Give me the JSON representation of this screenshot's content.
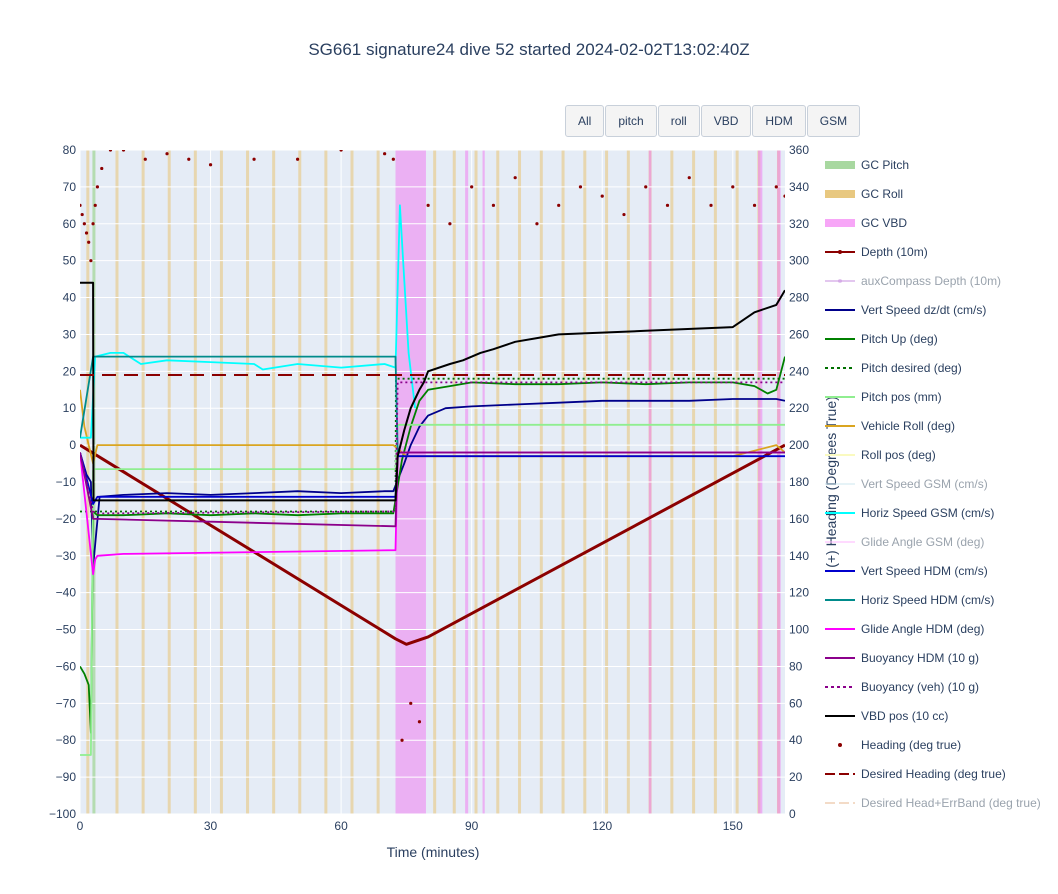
{
  "title": "SG661 signature24 dive 52 started 2024-02-02T13:02:40Z",
  "buttons": [
    "All",
    "pitch",
    "roll",
    "VBD",
    "HDM",
    "GSM"
  ],
  "colors": {
    "plot_bg": "#e5ecf6",
    "gc_pitch": "#a8d8a0",
    "gc_roll": "#e8c880",
    "gc_vbd": "#f080f0",
    "depth": "#8b0000",
    "aux_depth": "#c890e0",
    "vert_speed_dzdt": "#00008b",
    "pitch_up": "#008000",
    "pitch_desired": "#007000",
    "pitch_pos": "#90ee90",
    "vehicle_roll": "#daa520",
    "roll_pos": "#fafac0",
    "vert_speed_gsm": "#add8e6",
    "horiz_speed_gsm": "#00ffff",
    "glide_angle_gsm": "#ffb6ff",
    "vert_speed_hdm": "#0000cd",
    "horiz_speed_hdm": "#008b8b",
    "glide_angle_hdm": "#ff00ff",
    "buoyancy_hdm": "#8b008b",
    "buoyancy_veh": "#8b008b",
    "vbd_pos": "#000000",
    "heading": "#8b0000",
    "desired_heading": "#8b0000",
    "errband": "#e8b890"
  },
  "legend": [
    {
      "label": "GC Pitch",
      "symbol": "band",
      "color": "#a8d8a0",
      "visible": true
    },
    {
      "label": "GC Roll",
      "symbol": "band",
      "color": "#e8c880",
      "visible": true
    },
    {
      "label": "GC VBD",
      "symbol": "band",
      "color": "#f7a6f7",
      "visible": true
    },
    {
      "label": "Depth (10m)",
      "symbol": "line-marker",
      "color": "#8b0000",
      "visible": true
    },
    {
      "label": "auxCompass Depth (10m)",
      "symbol": "line-marker",
      "color": "#c890e0",
      "visible": false
    },
    {
      "label": "Vert Speed dz/dt (cm/s)",
      "symbol": "line",
      "color": "#00008b",
      "visible": true
    },
    {
      "label": "Pitch Up (deg)",
      "symbol": "line",
      "color": "#008000",
      "visible": true
    },
    {
      "label": "Pitch desired (deg)",
      "symbol": "dot",
      "color": "#007000",
      "visible": true
    },
    {
      "label": "Pitch pos (mm)",
      "symbol": "line",
      "color": "#90ee90",
      "visible": true
    },
    {
      "label": "Vehicle Roll (deg)",
      "symbol": "line",
      "color": "#daa520",
      "visible": true
    },
    {
      "label": "Roll pos (deg)",
      "symbol": "line",
      "color": "#fafac0",
      "visible": true
    },
    {
      "label": "Vert Speed GSM (cm/s)",
      "symbol": "line",
      "color": "#cfe8f0",
      "visible": false
    },
    {
      "label": "Horiz Speed GSM (cm/s)",
      "symbol": "line",
      "color": "#00ffff",
      "visible": true
    },
    {
      "label": "Glide Angle GSM (deg)",
      "symbol": "line",
      "color": "#ffb6ff",
      "visible": false
    },
    {
      "label": "Vert Speed HDM (cm/s)",
      "symbol": "line",
      "color": "#0000cd",
      "visible": true
    },
    {
      "label": "Horiz Speed HDM (cm/s)",
      "symbol": "line",
      "color": "#008b8b",
      "visible": true
    },
    {
      "label": "Glide Angle HDM (deg)",
      "symbol": "line",
      "color": "#ff00ff",
      "visible": true
    },
    {
      "label": "Buoyancy HDM (10 g)",
      "symbol": "line",
      "color": "#8b008b",
      "visible": true
    },
    {
      "label": "Buoyancy (veh) (10 g)",
      "symbol": "dot",
      "color": "#8b008b",
      "visible": true
    },
    {
      "label": "VBD pos (10 cc)",
      "symbol": "line",
      "color": "#000000",
      "visible": true
    },
    {
      "label": "Heading (deg true)",
      "symbol": "marker",
      "color": "#8b0000",
      "visible": true
    },
    {
      "label": "Desired Heading (deg true)",
      "symbol": "dash",
      "color": "#8b0000",
      "visible": true
    },
    {
      "label": "Desired Head+ErrBand (deg true)",
      "symbol": "dash",
      "color": "#e8b890",
      "visible": false
    }
  ],
  "chart_data": {
    "type": "line",
    "title": "SG661 signature24 dive 52 started 2024-02-02T13:02:40Z",
    "xlabel": "Time (minutes)",
    "ylabel": "",
    "y2label": "(+) Heading (Degrees True)",
    "xlim": [
      0,
      162
    ],
    "ylim": [
      -100,
      80
    ],
    "y2lim": [
      0,
      360
    ],
    "xticks": [
      0,
      30,
      60,
      90,
      120,
      150
    ],
    "yticks": [
      80,
      70,
      60,
      50,
      40,
      30,
      20,
      10,
      0,
      -10,
      -20,
      -30,
      -40,
      -50,
      -60,
      -70,
      -80,
      -90,
      -100
    ],
    "y2ticks": [
      360,
      340,
      320,
      300,
      280,
      260,
      240,
      220,
      200,
      180,
      160,
      140,
      120,
      100,
      80,
      60,
      40,
      20,
      0
    ],
    "grid": true,
    "legend_position": "right",
    "gc_pitch_x": [
      3.2
    ],
    "gc_roll_x": [
      1.8,
      8.5,
      14.5,
      20.5,
      26.5,
      32.5,
      38.5,
      44.5,
      50.5,
      56.5,
      62.5,
      68.5,
      81.5,
      86,
      91,
      96,
      101,
      106,
      111,
      116,
      121,
      126,
      131,
      136,
      141,
      146,
      151,
      156,
      160.5
    ],
    "gc_vbd_bands": [
      [
        72.5,
        79.5
      ],
      [
        88.5,
        89.2
      ],
      [
        92.5,
        93
      ],
      [
        130.7,
        131.3
      ],
      [
        155.8,
        156.8
      ],
      [
        160.2,
        161
      ]
    ],
    "series": [
      {
        "name": "Depth (10m)",
        "x": [
          0,
          72.5,
          75,
          80,
          162
        ],
        "y": [
          0,
          -52.5,
          -54,
          -52,
          0
        ],
        "y_unit": "10m"
      },
      {
        "name": "Vert Speed dz/dt (cm/s)",
        "x": [
          0,
          1.5,
          2.5,
          3.0,
          4.5,
          10,
          20,
          30,
          40,
          50,
          60,
          70,
          72,
          74.5,
          76,
          78,
          80,
          84,
          90,
          100,
          110,
          120,
          130,
          140,
          150,
          160,
          162
        ],
        "y": [
          -2,
          -8,
          -10,
          -33,
          -14,
          -13.5,
          -13,
          -13.5,
          -13,
          -12.5,
          -13,
          -12.5,
          -12.5,
          -5,
          0,
          5,
          8,
          10,
          10.5,
          11,
          11.5,
          12,
          12,
          12,
          12.5,
          12.5,
          12
        ]
      },
      {
        "name": "Pitch Up (deg)",
        "x": [
          0,
          1,
          2,
          2.5,
          3,
          4,
          10,
          20,
          30,
          40,
          50,
          60,
          70,
          72,
          74,
          76,
          78,
          80,
          85,
          90,
          100,
          110,
          120,
          130,
          140,
          150,
          155,
          158,
          160,
          162
        ],
        "y": [
          -60,
          -62,
          -65,
          -78,
          -18,
          -19,
          -19,
          -18.5,
          -19,
          -18.5,
          -19,
          -18.5,
          -18.5,
          -18.5,
          -4,
          5,
          12,
          15,
          16,
          17,
          16.5,
          16.5,
          17,
          16.5,
          17,
          17,
          16,
          14,
          15,
          24
        ]
      },
      {
        "name": "Pitch desired (deg)",
        "x": [
          0,
          72.5,
          72.6,
          162
        ],
        "y": [
          -18,
          -18,
          18,
          18
        ],
        "dash": "dot"
      },
      {
        "name": "Pitch pos (mm)",
        "x": [
          0,
          2.5,
          3,
          3.2,
          72.5,
          73,
          80,
          162
        ],
        "y": [
          -84,
          -84,
          -7,
          -6.5,
          -6.5,
          5.5,
          5.5,
          5.5
        ]
      },
      {
        "name": "Vehicle Roll (deg)",
        "x": [
          0,
          1,
          2,
          3,
          4,
          10,
          40,
          72,
          75,
          80,
          90,
          120,
          150,
          160,
          162
        ],
        "y": [
          15,
          5,
          0,
          -5,
          0,
          0,
          0,
          0,
          -3,
          -3,
          -3,
          -3,
          -3,
          0,
          -2
        ]
      },
      {
        "name": "Horiz Speed GSM (cm/s)",
        "x": [
          0,
          2.5,
          3.5,
          7,
          10,
          14,
          20,
          30,
          40,
          42,
          50,
          60,
          70,
          72.5,
          73.5,
          74.5,
          75.5,
          77
        ],
        "y": [
          2,
          2,
          24,
          25,
          25,
          22,
          23,
          22.5,
          22,
          20.5,
          22,
          21,
          22,
          21,
          65,
          45,
          25,
          10
        ]
      },
      {
        "name": "Vert Speed HDM (cm/s)",
        "x": [
          0,
          3,
          4,
          72.5,
          73,
          162
        ],
        "y": [
          -2,
          -16,
          -14,
          -14,
          -3,
          -3
        ]
      },
      {
        "name": "Horiz Speed HDM (cm/s)",
        "x": [
          0,
          3,
          4,
          72.5,
          73,
          162
        ],
        "y": [
          2,
          24,
          24,
          24,
          -2,
          -2
        ]
      },
      {
        "name": "Glide Angle HDM (deg)",
        "x": [
          0,
          3,
          3.5,
          4,
          10,
          72.5,
          73,
          162
        ],
        "y": [
          -2,
          -35,
          -31,
          -30,
          -29.5,
          -28.5,
          -2,
          -2
        ]
      },
      {
        "name": "Buoyancy HDM (10 g)",
        "x": [
          0,
          3,
          4,
          72.5,
          73,
          162
        ],
        "y": [
          -2,
          -20,
          -20,
          -22,
          -2,
          -2
        ]
      },
      {
        "name": "Buoyancy (veh) (10 g)",
        "x": [
          0,
          3,
          4,
          72.5,
          73,
          162
        ],
        "y": [
          -2,
          -18,
          -18.5,
          -18,
          17,
          17
        ],
        "dash": "dot"
      },
      {
        "name": "VBD pos (10 cc)",
        "x": [
          0,
          3,
          3.1,
          72.5,
          73,
          74.5,
          76,
          78,
          79,
          80,
          85,
          88,
          92,
          95,
          100,
          105,
          110,
          130,
          150,
          155,
          160,
          162
        ],
        "y": [
          44,
          44,
          -15,
          -15,
          -3,
          4,
          10,
          15,
          17,
          20,
          22,
          23,
          25,
          26,
          28,
          29,
          30,
          31,
          32,
          36,
          38,
          42
        ]
      },
      {
        "name": "Desired Heading (deg true)",
        "x": [
          0,
          162
        ],
        "y": [
          238,
          238
        ],
        "axis": "y2",
        "dash": "dash"
      },
      {
        "name": "Heading (deg true)",
        "x": [
          0,
          0.5,
          1,
          1.5,
          2,
          2.5,
          3,
          3.5,
          4,
          5,
          7,
          10,
          15,
          20,
          25,
          30,
          40,
          50,
          60,
          70,
          72,
          74,
          76,
          78,
          80,
          85,
          90,
          95,
          100,
          105,
          110,
          115,
          120,
          125,
          130,
          135,
          140,
          145,
          150,
          155,
          160,
          162
        ],
        "y": [
          330,
          325,
          320,
          315,
          310,
          300,
          320,
          330,
          340,
          350,
          360,
          360,
          355,
          358,
          355,
          352,
          355,
          355,
          360,
          358,
          355,
          40,
          60,
          50,
          330,
          320,
          340,
          330,
          345,
          320,
          330,
          340,
          335,
          325,
          340,
          330,
          345,
          330,
          340,
          330,
          340,
          335
        ],
        "axis": "y2",
        "mode": "markers"
      }
    ]
  }
}
